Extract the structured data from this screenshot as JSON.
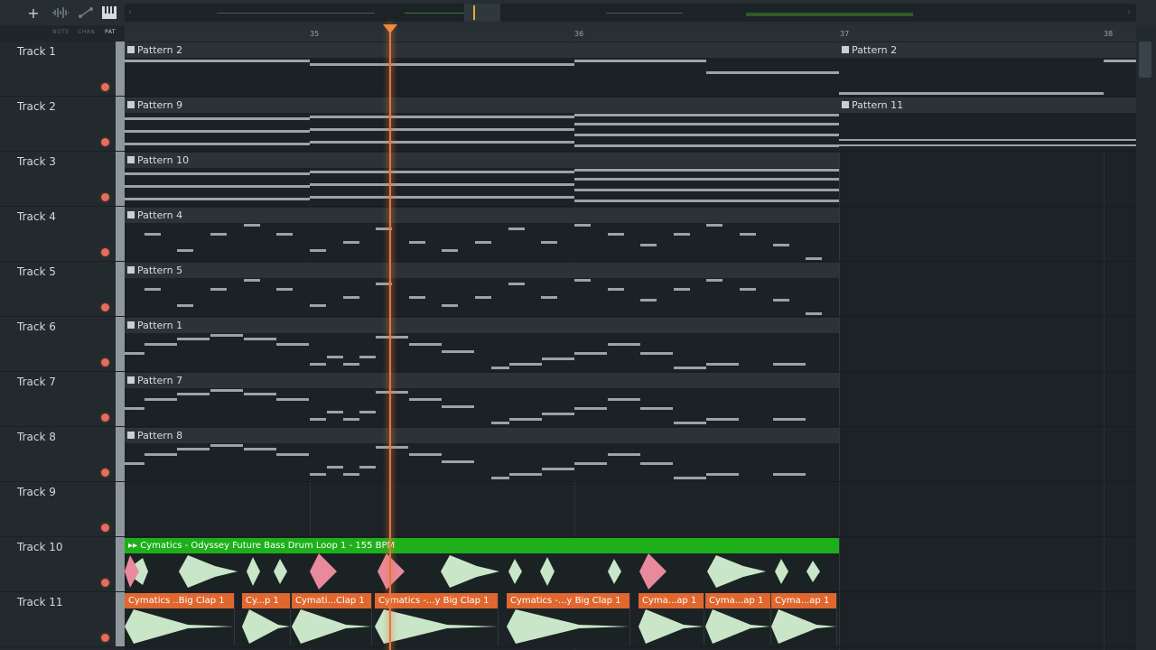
{
  "toolbar": {
    "add_icon": "plus-icon",
    "labels": [
      "NOTE",
      "CHAN",
      "PAT"
    ],
    "colors": {
      "accent": "#f08a3c",
      "green": "#1db01a",
      "clip_header": "#2b3338"
    }
  },
  "ruler": {
    "bars": [
      "35",
      "36",
      "37",
      "38"
    ]
  },
  "tracks": [
    {
      "name": "Track 1"
    },
    {
      "name": "Track 2"
    },
    {
      "name": "Track 3"
    },
    {
      "name": "Track 4"
    },
    {
      "name": "Track 5"
    },
    {
      "name": "Track 6"
    },
    {
      "name": "Track 7"
    },
    {
      "name": "Track 8"
    },
    {
      "name": "Track 9"
    },
    {
      "name": "Track 10"
    },
    {
      "name": "Track 11"
    }
  ],
  "clips": {
    "t1a": "Pattern 2",
    "t1b": "Pattern 2",
    "t2a": "Pattern 9",
    "t2b": "Pattern 11",
    "t3a": "Pattern 10",
    "t4a": "Pattern 4",
    "t5a": "Pattern 5",
    "t6a": "Pattern 1",
    "t7a": "Pattern 7",
    "t8a": "Pattern 8",
    "t10a": "Cymatics - Odyssey Future Bass Drum Loop 1 - 155 BPM",
    "t11": [
      "Cymatics ..Big Clap 1",
      "Cy...p 1",
      "Cymati...Clap 1",
      "Cymatics -...y Big Clap 1",
      "Cymatics -...y Big Clap 1",
      "Cyma...ap 1",
      "Cyma...ap 1",
      "Cyma...ap 1"
    ]
  }
}
